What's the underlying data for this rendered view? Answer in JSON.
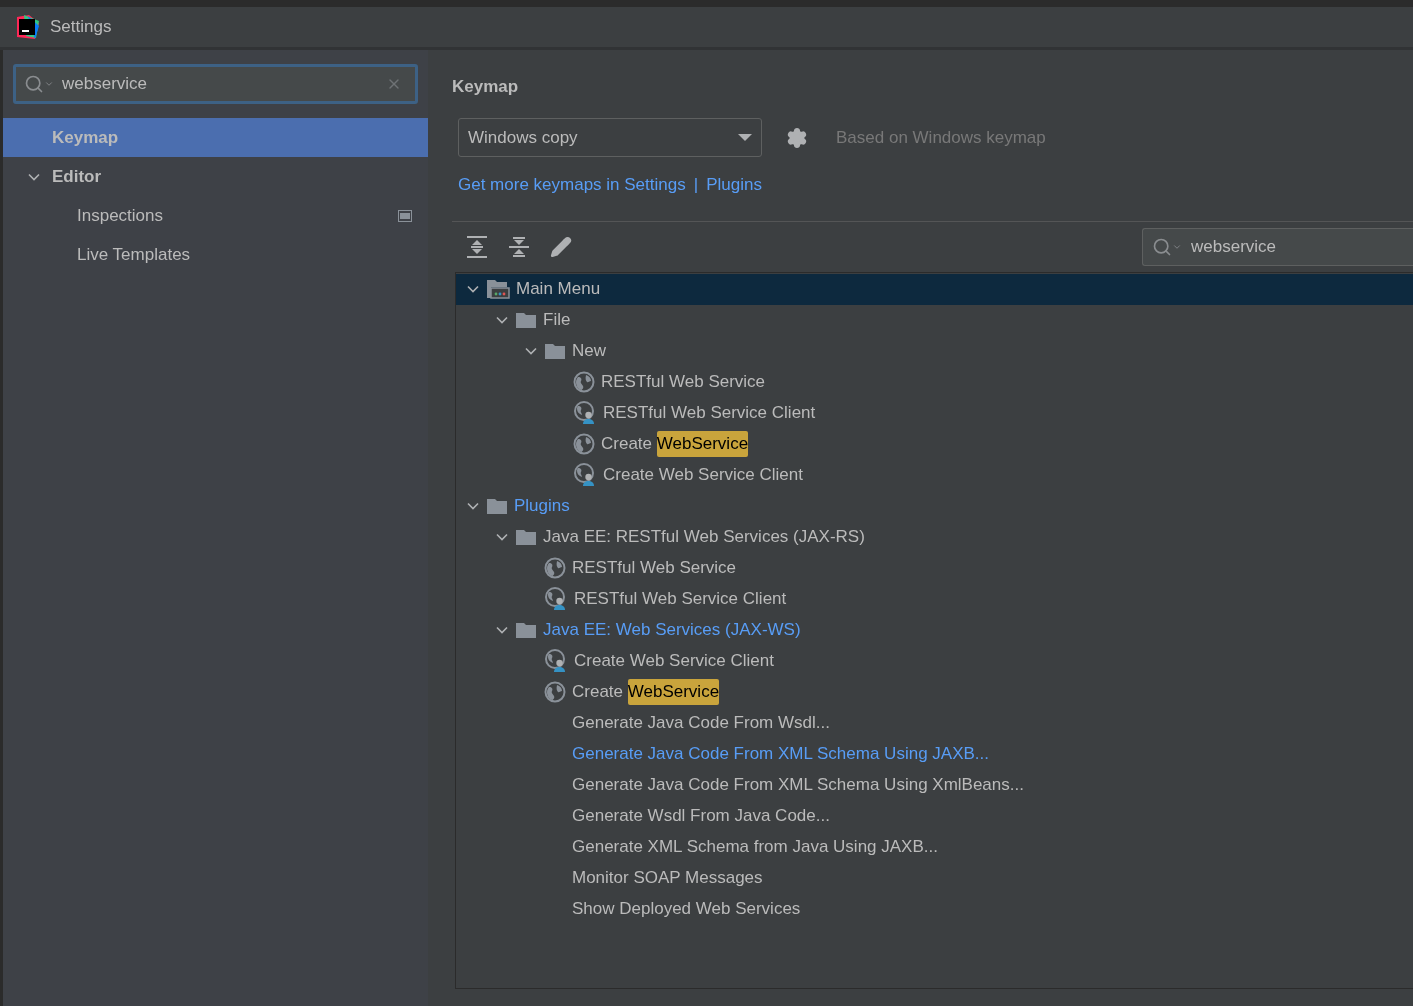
{
  "window": {
    "title": "Settings"
  },
  "sidebar": {
    "search": {
      "value": "webservice"
    },
    "items": [
      {
        "label": "Keymap",
        "selected": true
      },
      {
        "label": "Editor",
        "selected": false,
        "expanded": true,
        "children": [
          {
            "label": "Inspections",
            "selected": false,
            "badge": true
          },
          {
            "label": "Live Templates",
            "selected": false,
            "badge": false
          }
        ]
      }
    ]
  },
  "content": {
    "heading": "Keymap",
    "keymap_select": {
      "value": "Windows copy"
    },
    "based_on": "Based on Windows keymap",
    "links": [
      "Get more keymaps in Settings",
      "Plugins"
    ],
    "link_separator": "|",
    "filter": {
      "value": "webservice"
    },
    "tree": [
      {
        "kind": "menu",
        "label": "Main Menu",
        "selected": true,
        "modified": false,
        "expanded": true,
        "children": [
          {
            "kind": "group",
            "label": "File",
            "selected": false,
            "modified": false,
            "expanded": true,
            "children": [
              {
                "kind": "group",
                "label": "New",
                "selected": false,
                "modified": false,
                "expanded": true,
                "children": [
                  {
                    "kind": "service",
                    "label": "RESTful Web Service",
                    "selected": false,
                    "modified": false
                  },
                  {
                    "kind": "client",
                    "label": "RESTful Web Service Client",
                    "selected": false,
                    "modified": false
                  },
                  {
                    "kind": "service",
                    "label": "Create ",
                    "match": "WebService",
                    "selected": false,
                    "modified": false
                  },
                  {
                    "kind": "client",
                    "label": "Create Web Service Client",
                    "selected": false,
                    "modified": false
                  }
                ]
              }
            ]
          }
        ]
      },
      {
        "kind": "group",
        "label": "Plugins",
        "selected": false,
        "modified": true,
        "expanded": true,
        "children": [
          {
            "kind": "group",
            "label": "Java EE: RESTful Web Services (JAX-RS)",
            "selected": false,
            "modified": false,
            "expanded": true,
            "children": [
              {
                "kind": "service",
                "label": "RESTful Web Service",
                "selected": false,
                "modified": false
              },
              {
                "kind": "client",
                "label": "RESTful Web Service Client",
                "selected": false,
                "modified": false
              }
            ]
          },
          {
            "kind": "group",
            "label": "Java EE: Web Services (JAX-WS)",
            "selected": false,
            "modified": true,
            "expanded": true,
            "children": [
              {
                "kind": "client",
                "label": "Create Web Service Client",
                "selected": false,
                "modified": false
              },
              {
                "kind": "service",
                "label": "Create ",
                "match": "WebService",
                "selected": false,
                "modified": false
              },
              {
                "kind": "action",
                "label": "Generate Java Code From Wsdl...",
                "selected": false,
                "modified": false
              },
              {
                "kind": "action",
                "label": "Generate Java Code From XML Schema Using JAXB...",
                "selected": false,
                "modified": true
              },
              {
                "kind": "action",
                "label": "Generate Java Code From XML Schema Using XmlBeans...",
                "selected": false,
                "modified": false
              },
              {
                "kind": "action",
                "label": "Generate Wsdl From Java Code...",
                "selected": false,
                "modified": false
              },
              {
                "kind": "action",
                "label": "Generate XML Schema from Java Using JAXB...",
                "selected": false,
                "modified": false
              },
              {
                "kind": "action",
                "label": "Monitor SOAP Messages",
                "selected": false,
                "modified": false
              },
              {
                "kind": "action",
                "label": "Show Deployed Web Services",
                "selected": false,
                "modified": false
              }
            ]
          }
        ]
      }
    ]
  }
}
